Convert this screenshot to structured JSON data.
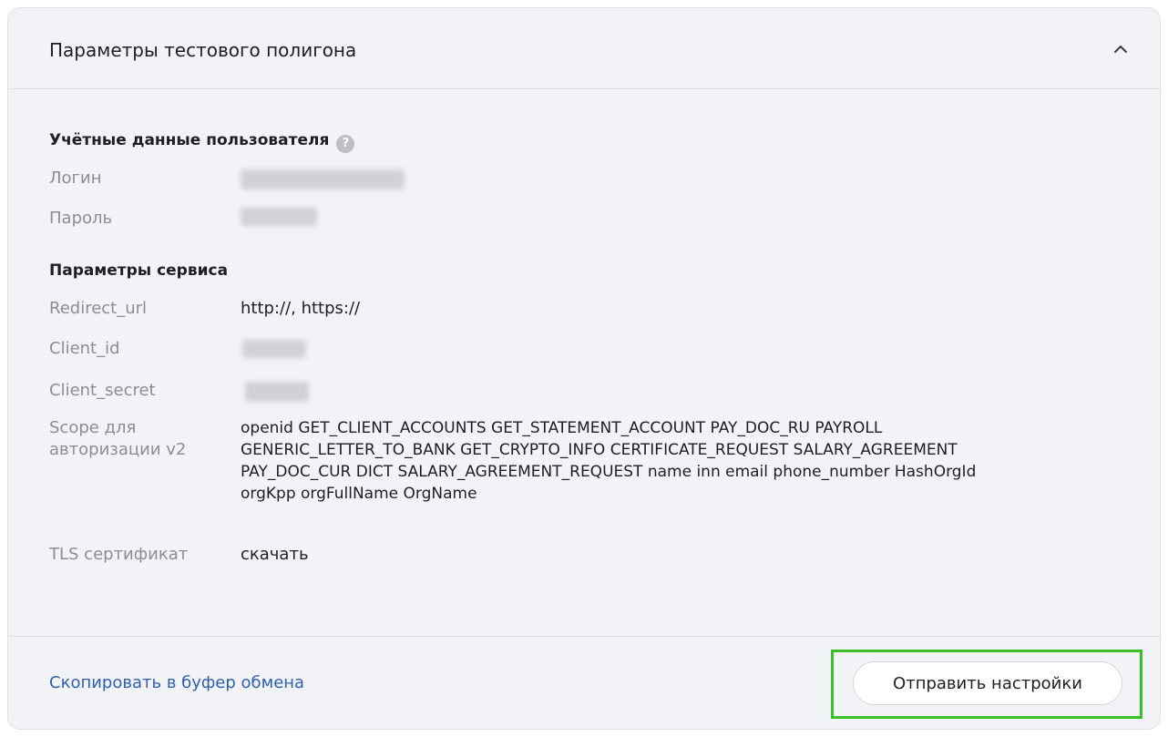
{
  "panel": {
    "title": "Параметры тестового полигона",
    "collapse_icon": "chevron-up-icon"
  },
  "credentials": {
    "title": "Учётные данные пользователя",
    "help_icon": "question-icon",
    "help_glyph": "?",
    "login_label": "Логин",
    "password_label": "Пароль"
  },
  "service": {
    "title": "Параметры сервиса",
    "redirect_label": "Redirect_url",
    "redirect_value": "http://, https://",
    "client_id_label": "Client_id",
    "client_secret_label": "Client_secret",
    "scope_label": "Scope для\nавторизации v2",
    "scope_value": "openid GET_CLIENT_ACCOUNTS GET_STATEMENT_ACCOUNT PAY_DOC_RU PAYROLL\nGENERIC_LETTER_TO_BANK GET_CRYPTO_INFO CERTIFICATE_REQUEST SALARY_AGREEMENT\nPAY_DOC_CUR DICT SALARY_AGREEMENT_REQUEST name inn email phone_number HashOrgId\norgKpp orgFullName OrgName",
    "tls_label": "TLS сертификат",
    "tls_link": "скачать"
  },
  "footer": {
    "copy_link": "Скопировать в буфер обмена",
    "send_button": "Отправить настройки"
  },
  "colors": {
    "panel_bg": "#f2f3f7",
    "link": "#2f5fa8",
    "highlight": "#3bbf2a",
    "label": "#8a8d95"
  }
}
